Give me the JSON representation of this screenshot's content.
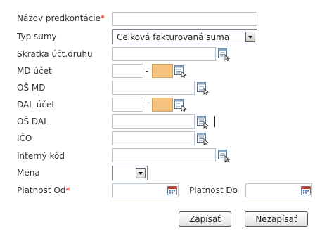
{
  "fields": {
    "nazov_predkontacie": {
      "label": "Názov predkontácie",
      "required_marker": "*",
      "value": ""
    },
    "typ_sumy": {
      "label": "Typ sumy",
      "selected": "Celková fakturovaná suma"
    },
    "skratka": {
      "label": "Skratka účt.druhu",
      "value": ""
    },
    "md_ucet": {
      "label": "MD účet",
      "dash": "-",
      "value_left": "",
      "value_right": ""
    },
    "os_md": {
      "label": "OŠ MD",
      "value": ""
    },
    "dal_ucet": {
      "label": "DAL účet",
      "dash": "-",
      "value_left": "",
      "value_right": ""
    },
    "os_dal": {
      "label": "OŠ DAL",
      "value": ""
    },
    "ico": {
      "label": "IČO",
      "value": ""
    },
    "interny_kod": {
      "label": "Interný kód",
      "value": ""
    },
    "mena": {
      "label": "Mena",
      "selected": ""
    },
    "platnost_od": {
      "label": "Platnost Od",
      "required_marker": "*",
      "value": ""
    },
    "platnost_do": {
      "label": "Platnost Do",
      "value": ""
    }
  },
  "buttons": {
    "save": "Zapísať",
    "cancel": "Nezapísať"
  },
  "colors": {
    "required": "#d00000",
    "highlight_field": "#f6c37f",
    "field_border": "#b8c4cf"
  },
  "icons": {
    "lookup": "list-lookup-icon",
    "calendar": "calendar-icon"
  }
}
